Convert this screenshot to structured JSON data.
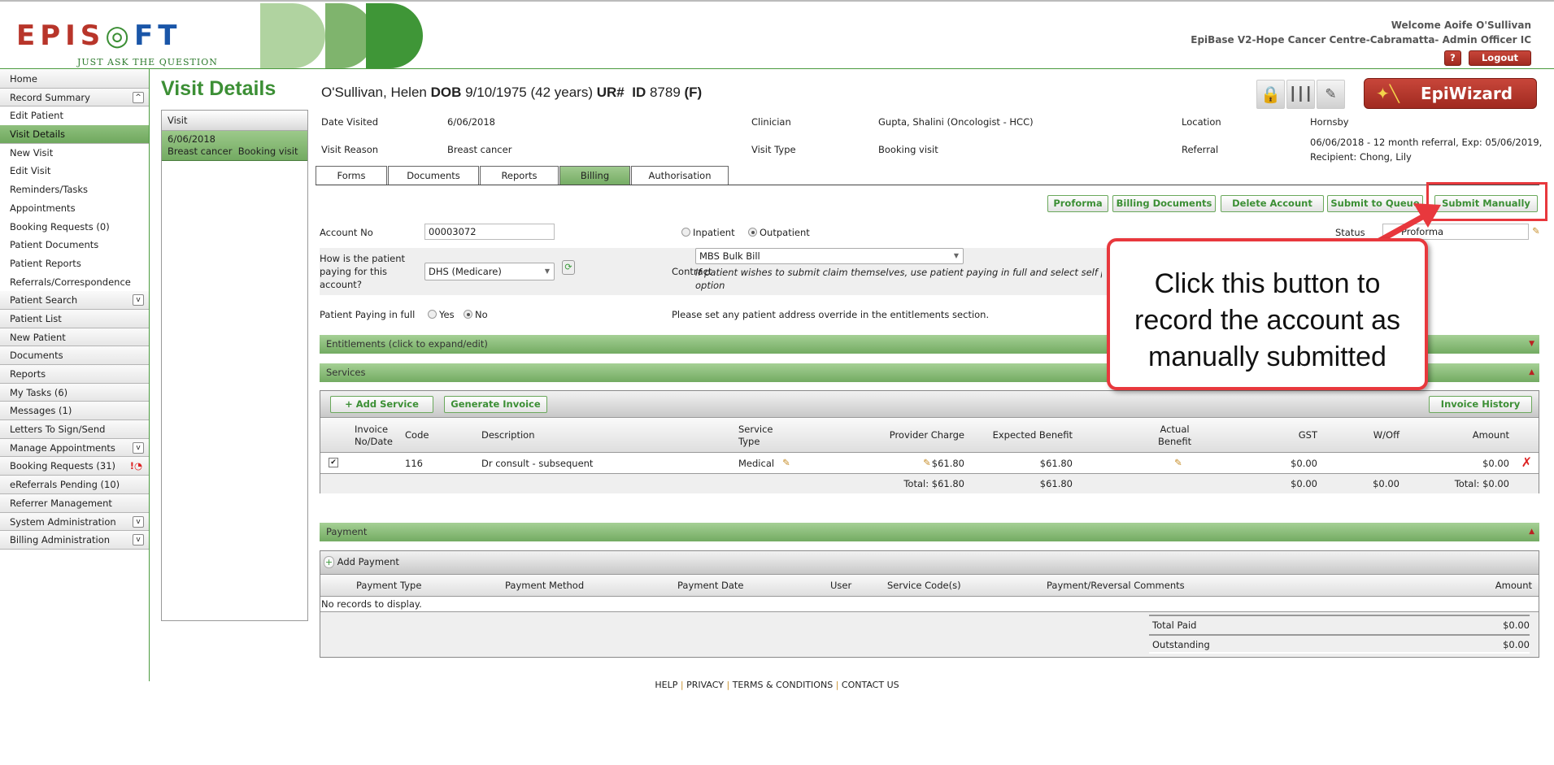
{
  "header": {
    "logo_text": "EPISOFT",
    "tagline": "JUST ASK THE QUESTION",
    "welcome": "Welcome Aoife O'Sullivan",
    "context": "EpiBase V2-Hope Cancer Centre-Cabramatta- Admin Officer IC",
    "help_label": "?",
    "logout_label": "Logout",
    "epiwizard_label": "EpiWizard",
    "colors": {
      "brand_green": "#3c8f35",
      "brand_red": "#b8352a",
      "brand_blue": "#1a56a8"
    }
  },
  "sidebar": {
    "items": [
      {
        "label": "Home"
      },
      {
        "label": "Record Summary",
        "chevron": "up"
      },
      {
        "label": "Edit Patient"
      },
      {
        "label": "Visit Details",
        "active": true
      },
      {
        "label": "New Visit"
      },
      {
        "label": "Edit Visit"
      },
      {
        "label": "Reminders/Tasks"
      },
      {
        "label": "Appointments"
      },
      {
        "label": "Booking Requests (0)"
      },
      {
        "label": "Patient Documents"
      },
      {
        "label": "Patient Reports"
      },
      {
        "label": "Referrals/Correspondence"
      },
      {
        "label": "Patient Search",
        "chevron": "down"
      },
      {
        "label": "Patient List"
      },
      {
        "label": "New Patient"
      },
      {
        "label": "Documents"
      },
      {
        "label": "Reports"
      },
      {
        "label": "My Tasks (6)"
      },
      {
        "label": "Messages (1)"
      },
      {
        "label": "Letters To Sign/Send"
      },
      {
        "label": "Manage Appointments",
        "chevron": "down"
      },
      {
        "label": "Booking Requests (31)",
        "alert": true
      },
      {
        "label": "eReferrals Pending (10)"
      },
      {
        "label": "Referrer Management"
      },
      {
        "label": "System Administration",
        "chevron": "down"
      },
      {
        "label": "Billing Administration",
        "chevron": "down"
      }
    ]
  },
  "page": {
    "title": "Visit Details",
    "patient": {
      "name": "O'Sullivan, Helen",
      "dob_label": "DOB",
      "dob": "9/10/1975 (42 years)",
      "ur_label": "UR#",
      "id_label": "ID",
      "id": "8789",
      "sex": "(F)"
    }
  },
  "visit_panel": {
    "header": "Visit",
    "date": "6/06/2018",
    "reason": "Breast cancer",
    "type": "Booking visit"
  },
  "visit_info": {
    "date_visited_label": "Date Visited",
    "date_visited": "6/06/2018",
    "clinician_label": "Clinician",
    "clinician": "Gupta, Shalini (Oncologist - HCC)",
    "location_label": "Location",
    "location": "Hornsby",
    "reason_label": "Visit Reason",
    "reason": "Breast cancer",
    "type_label": "Visit Type",
    "type": "Booking visit",
    "referral_label": "Referral",
    "referral_line1": "06/06/2018 - 12 month referral, Exp: 05/06/2019,",
    "referral_line2": "Recipient: Chong, Lily"
  },
  "tabs": [
    "Forms",
    "Documents",
    "Reports",
    "Billing",
    "Authorisation"
  ],
  "active_tab": "Billing",
  "billing": {
    "actions": [
      "Proforma",
      "Billing Documents",
      "Delete Account",
      "Submit to Queue",
      "Submit Manually"
    ],
    "account_no_label": "Account No",
    "account_no": "00003072",
    "inpatient_label": "Inpatient",
    "outpatient_label": "Outpatient",
    "admission": "Outpatient",
    "status_label": "Status",
    "status": "Proforma",
    "paying_label_1": "How is the patient",
    "paying_label_2": "paying for this",
    "paying_label_3": "account?",
    "paying_value": "DHS (Medicare)",
    "contract_label": "Contract",
    "contract_value": "MBS Bulk Bill",
    "contract_note_1": "If patient wishes to submit claim themselves, use patient paying in full and select self pa",
    "contract_note_2": "option",
    "paying_full_label": "Patient Paying in full",
    "yes_label": "Yes",
    "no_label": "No",
    "paying_full": "No",
    "address_note": "Please set any patient address override in the entitlements section.",
    "entitlements_label": "Entitlements (click to expand/edit)",
    "services_label": "Services"
  },
  "services": {
    "add_label": "+ Add Service",
    "generate_label": "Generate Invoice",
    "history_label": "Invoice History",
    "columns": {
      "invoice_1": "Invoice",
      "invoice_2": "No/Date",
      "code": "Code",
      "description": "Description",
      "stype_1": "Service",
      "stype_2": "Type",
      "provider": "Provider Charge",
      "expected": "Expected Benefit",
      "actual_1": "Actual",
      "actual_2": "Benefit",
      "gst": "GST",
      "woff": "W/Off",
      "amount": "Amount"
    },
    "rows": [
      {
        "checked": true,
        "code": "116",
        "description": "Dr consult - subsequent",
        "service_type": "Medical",
        "provider_charge": "$61.80",
        "expected_benefit": "$61.80",
        "gst": "$0.00",
        "amount": "$0.00"
      }
    ],
    "totals": {
      "provider": "Total: $61.80",
      "expected": "$61.80",
      "gst": "$0.00",
      "woff": "$0.00",
      "amount": "Total: $0.00"
    }
  },
  "payment": {
    "label": "Payment",
    "add_label": "Add Payment",
    "columns": [
      "Payment Type",
      "Payment Method",
      "Payment Date",
      "User",
      "Service Code(s)",
      "Payment/Reversal Comments",
      "Amount"
    ],
    "empty": "No records to display.",
    "total_paid_label": "Total Paid",
    "total_paid": "$0.00",
    "outstanding_label": "Outstanding",
    "outstanding": "$0.00"
  },
  "callout": {
    "line1": "Click this button to",
    "line2": "record the account as",
    "line3": "manually submitted",
    "color": "#e8383d"
  },
  "footer": [
    "HELP",
    "PRIVACY",
    "TERMS & CONDITIONS",
    "CONTACT US"
  ]
}
